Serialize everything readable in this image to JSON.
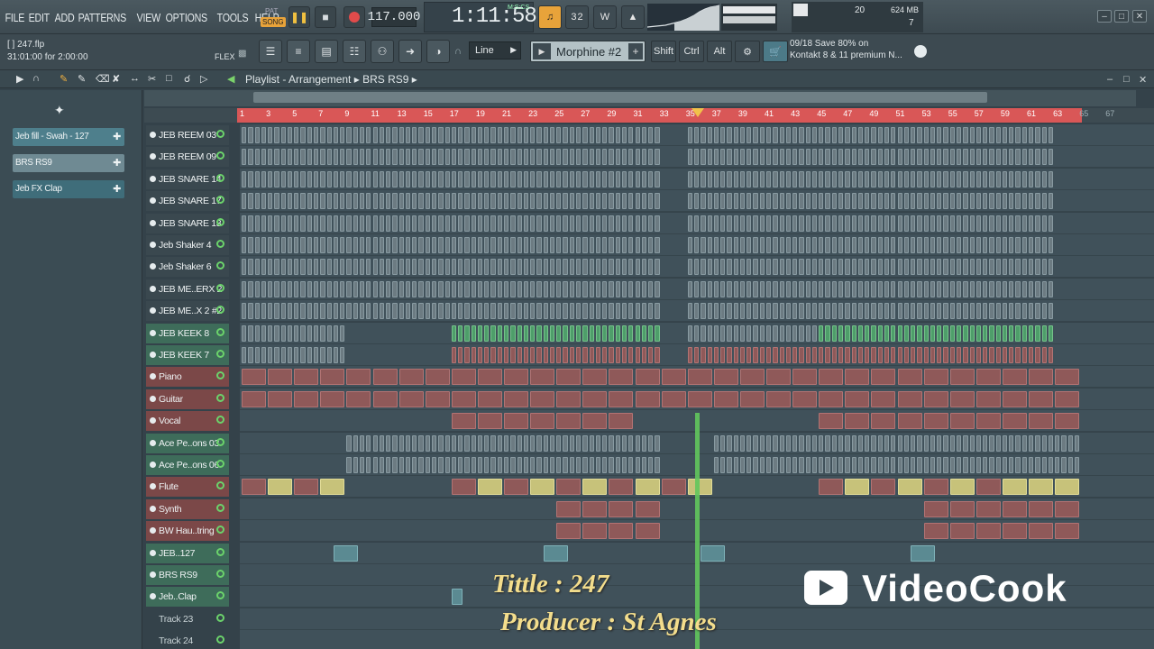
{
  "menu": [
    "FILE",
    "EDIT",
    "ADD",
    "PATTERNS",
    "VIEW",
    "OPTIONS",
    "TOOLS",
    "HELP"
  ],
  "transport": {
    "pat_label": "PAT",
    "song_label": "SONG",
    "tempo": "117.000",
    "time": "1:11:58",
    "time_units": "M:S:CS"
  },
  "memory": {
    "value": "624 MB",
    "cpu_num": "20",
    "poly": "7"
  },
  "project": {
    "file": "[ ] 247.flp",
    "time_info": "31:01:00 for 2:00:00",
    "flex": "FLEX"
  },
  "toolbar": {
    "snap": "Line",
    "preset": "Morphine #2",
    "mod_shift": "Shift",
    "mod_ctrl": "Ctrl",
    "mod_alt": "Alt"
  },
  "news": {
    "line1": "09/18  Save 80% on",
    "line2": "Kontakt 8 & 11 premium N..."
  },
  "playlist": {
    "title": "Playlist - Arrangement",
    "pattern": "BRS RS9"
  },
  "picker": [
    {
      "label": "Jeb fill - Swah - 127",
      "color": "#4e7f8c"
    },
    {
      "label": "BRS RS9",
      "color": "#6f8a93"
    },
    {
      "label": "Jeb FX Clap",
      "color": "#3f6d7a"
    }
  ],
  "ruler": [
    "1",
    "3",
    "5",
    "7",
    "9",
    "11",
    "13",
    "15",
    "17",
    "19",
    "21",
    "23",
    "25",
    "27",
    "29",
    "31",
    "33",
    "35",
    "37",
    "39",
    "41",
    "43",
    "45",
    "47",
    "49",
    "51",
    "53",
    "55",
    "57",
    "59",
    "61",
    "63",
    "65",
    "67"
  ],
  "tracks": [
    {
      "name": "JEB REEM 03",
      "style": "dark"
    },
    {
      "name": "JEB REEM 09",
      "style": "dark"
    },
    {
      "name": "JEB SNARE 14",
      "style": "dark"
    },
    {
      "name": "JEB SNARE 17",
      "style": "dark"
    },
    {
      "name": "JEB SNARE 13",
      "style": "dark"
    },
    {
      "name": "Jeb Shaker 4",
      "style": "dark"
    },
    {
      "name": "Jeb Shaker 6",
      "style": "dark"
    },
    {
      "name": "JEB ME..ERX 2",
      "style": "dark"
    },
    {
      "name": "JEB ME..X 2 #2",
      "style": "dark"
    },
    {
      "name": "JEB KEEK 8",
      "style": "grn"
    },
    {
      "name": "JEB KEEK 7",
      "style": "grn"
    },
    {
      "name": "Piano",
      "style": "red"
    },
    {
      "name": "Guitar",
      "style": "red"
    },
    {
      "name": "Vocal",
      "style": "red"
    },
    {
      "name": "Ace Pe..ons 03",
      "style": "grn"
    },
    {
      "name": "Ace Pe..ons 06",
      "style": "grn"
    },
    {
      "name": "Flute",
      "style": "red"
    },
    {
      "name": "Synth",
      "style": "red"
    },
    {
      "name": "BW Hau..tring",
      "style": "red"
    },
    {
      "name": "JEB..127",
      "style": "grn"
    },
    {
      "name": "BRS RS9",
      "style": "grn"
    },
    {
      "name": "Jeb..Clap",
      "style": "grn"
    },
    {
      "name": "Track 23",
      "style": "plain"
    },
    {
      "name": "Track 24",
      "style": "plain"
    }
  ],
  "overlay": {
    "title": "Tittle : 247",
    "producer": "Producer : St Agnes",
    "watermark": "VideoCook"
  },
  "colors": {
    "clip_gray": "#6c7b82",
    "clip_green": "#4e9e6a",
    "clip_red": "#8f5959",
    "clip_yellow": "#c7c27a",
    "playhead": "#62c75c",
    "ruler": "#d95757"
  }
}
